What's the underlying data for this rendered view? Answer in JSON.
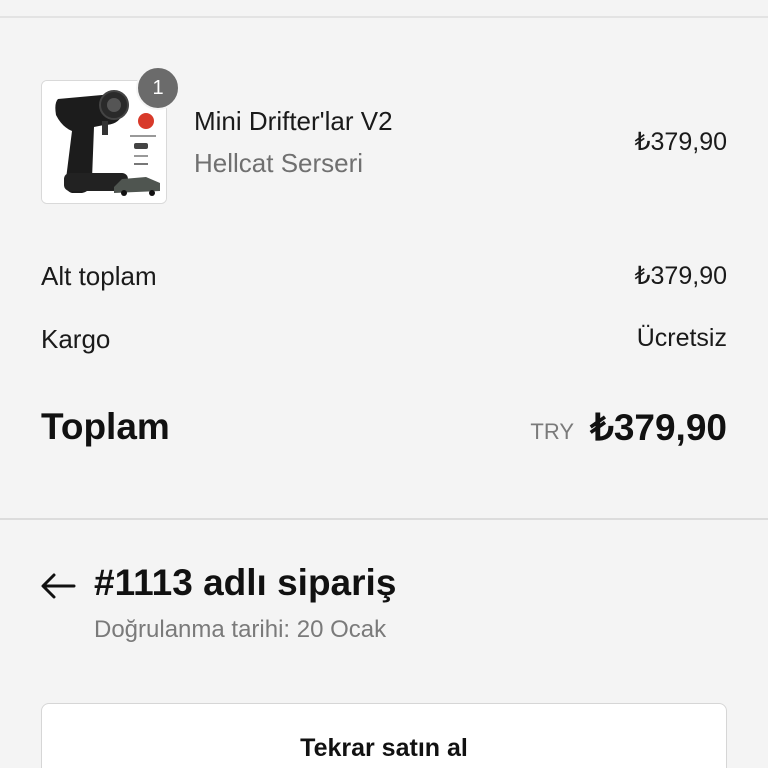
{
  "line_item": {
    "quantity": "1",
    "name": "Mini Drifter'lar V2",
    "variant": "Hellcat Serseri",
    "price": "₺379,90"
  },
  "summary": {
    "subtotal_label": "Alt toplam",
    "subtotal_value": "₺379,90",
    "shipping_label": "Kargo",
    "shipping_value": "Ücretsiz",
    "total_label": "Toplam",
    "total_currency": "TRY",
    "total_value": "₺379,90"
  },
  "order": {
    "title": "#1113 adlı sipariş",
    "subtitle": "Doğrulanma tarihi: 20 Ocak",
    "back_icon": "arrow-left-icon"
  },
  "actions": {
    "rebuy_label": "Tekrar satın al"
  },
  "colors": {
    "background": "#f4f4f4",
    "badge": "#6b6b6b",
    "muted_text": "#7a7a7a"
  }
}
